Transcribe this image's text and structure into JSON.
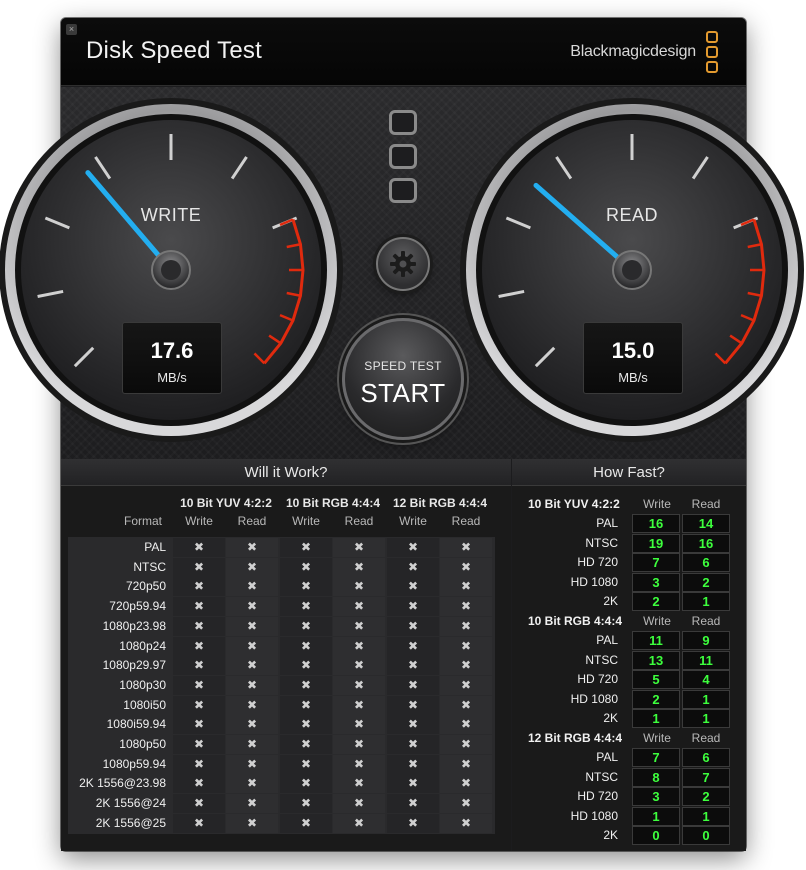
{
  "window": {
    "title": "Disk Speed Test",
    "brand": "Blackmagicdesign",
    "close_glyph": "×"
  },
  "gauges": {
    "write": {
      "label": "WRITE",
      "value": "17.6",
      "unit": "MB/s",
      "needle_fraction": 0.35
    },
    "read": {
      "label": "READ",
      "value": "15.0",
      "unit": "MB/s",
      "needle_fraction": 0.32
    }
  },
  "start": {
    "small": "SPEED TEST",
    "big": "START"
  },
  "icons": {
    "settings": "gear-icon",
    "check": "x-mark",
    "logo": "blackmagic-logo-icon"
  },
  "colors": {
    "needle": "#23aef0",
    "redline": "#e02a0e",
    "fast_value": "#3dff3d",
    "logo": "#e39a2f"
  },
  "will_it_work": {
    "title": "Will it Work?",
    "format_label": "Format",
    "groups": [
      "10 Bit YUV 4:2:2",
      "10 Bit RGB 4:4:4",
      "12 Bit RGB 4:4:4"
    ],
    "subcols": [
      "Write",
      "Read"
    ],
    "mark": "✖",
    "formats": [
      "PAL",
      "NTSC",
      "720p50",
      "720p59.94",
      "1080p23.98",
      "1080p24",
      "1080p29.97",
      "1080p30",
      "1080i50",
      "1080i59.94",
      "1080p50",
      "1080p59.94",
      "2K 1556@23.98",
      "2K 1556@24",
      "2K 1556@25"
    ]
  },
  "how_fast": {
    "title": "How Fast?",
    "col_write": "Write",
    "col_read": "Read",
    "sections": [
      {
        "name": "10 Bit YUV 4:2:2",
        "rows": [
          {
            "label": "PAL",
            "write": "16",
            "read": "14"
          },
          {
            "label": "NTSC",
            "write": "19",
            "read": "16"
          },
          {
            "label": "HD 720",
            "write": "7",
            "read": "6"
          },
          {
            "label": "HD 1080",
            "write": "3",
            "read": "2"
          },
          {
            "label": "2K",
            "write": "2",
            "read": "1"
          }
        ]
      },
      {
        "name": "10 Bit RGB 4:4:4",
        "rows": [
          {
            "label": "PAL",
            "write": "11",
            "read": "9"
          },
          {
            "label": "NTSC",
            "write": "13",
            "read": "11"
          },
          {
            "label": "HD 720",
            "write": "5",
            "read": "4"
          },
          {
            "label": "HD 1080",
            "write": "2",
            "read": "1"
          },
          {
            "label": "2K",
            "write": "1",
            "read": "1"
          }
        ]
      },
      {
        "name": "12 Bit RGB 4:4:4",
        "rows": [
          {
            "label": "PAL",
            "write": "7",
            "read": "6"
          },
          {
            "label": "NTSC",
            "write": "8",
            "read": "7"
          },
          {
            "label": "HD 720",
            "write": "3",
            "read": "2"
          },
          {
            "label": "HD 1080",
            "write": "1",
            "read": "1"
          },
          {
            "label": "2K",
            "write": "0",
            "read": "0"
          }
        ]
      }
    ]
  }
}
